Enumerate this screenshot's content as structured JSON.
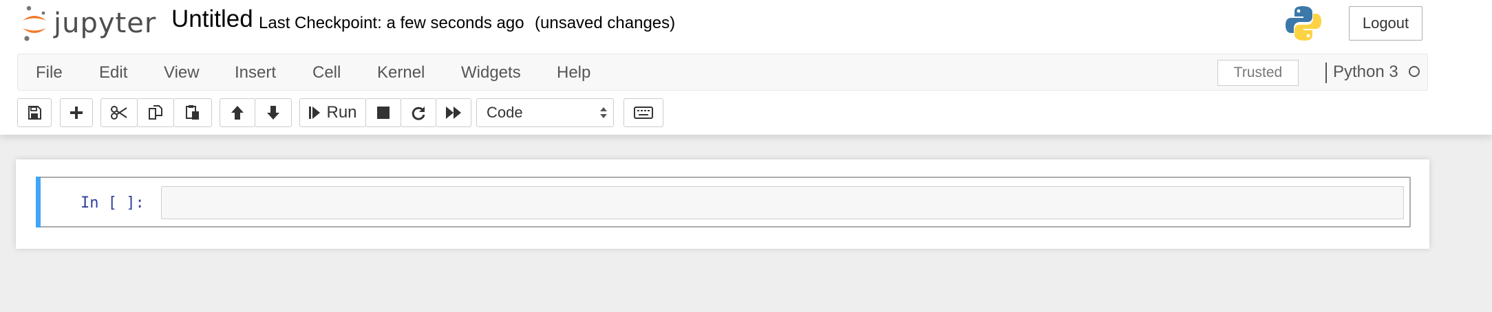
{
  "header": {
    "logo_text": "jupyter",
    "notebook_title": "Untitled",
    "checkpoint": "Last Checkpoint: a few seconds ago",
    "autosave_status": "(unsaved changes)",
    "logout_label": "Logout"
  },
  "menubar": {
    "items": [
      {
        "label": "File"
      },
      {
        "label": "Edit"
      },
      {
        "label": "View"
      },
      {
        "label": "Insert"
      },
      {
        "label": "Cell"
      },
      {
        "label": "Kernel"
      },
      {
        "label": "Widgets"
      },
      {
        "label": "Help"
      }
    ],
    "trusted_label": "Trusted",
    "kernel_name": "Python 3"
  },
  "toolbar": {
    "icons": [
      "save-icon",
      "plus-icon",
      "scissors-icon",
      "copy-icon",
      "paste-icon",
      "arrow-up-icon",
      "arrow-down-icon",
      "step-forward-icon",
      "stop-icon",
      "refresh-icon",
      "fast-forward-icon",
      "keyboard-icon"
    ],
    "run_label": "Run",
    "cell_type": "Code"
  },
  "notebook": {
    "cells": [
      {
        "prompt": "In [ ]:",
        "source": ""
      }
    ]
  },
  "colors": {
    "jupyter_orange": "#f37726",
    "cell_selected_bar": "#42a5f5",
    "prompt_blue": "#303f9f"
  }
}
